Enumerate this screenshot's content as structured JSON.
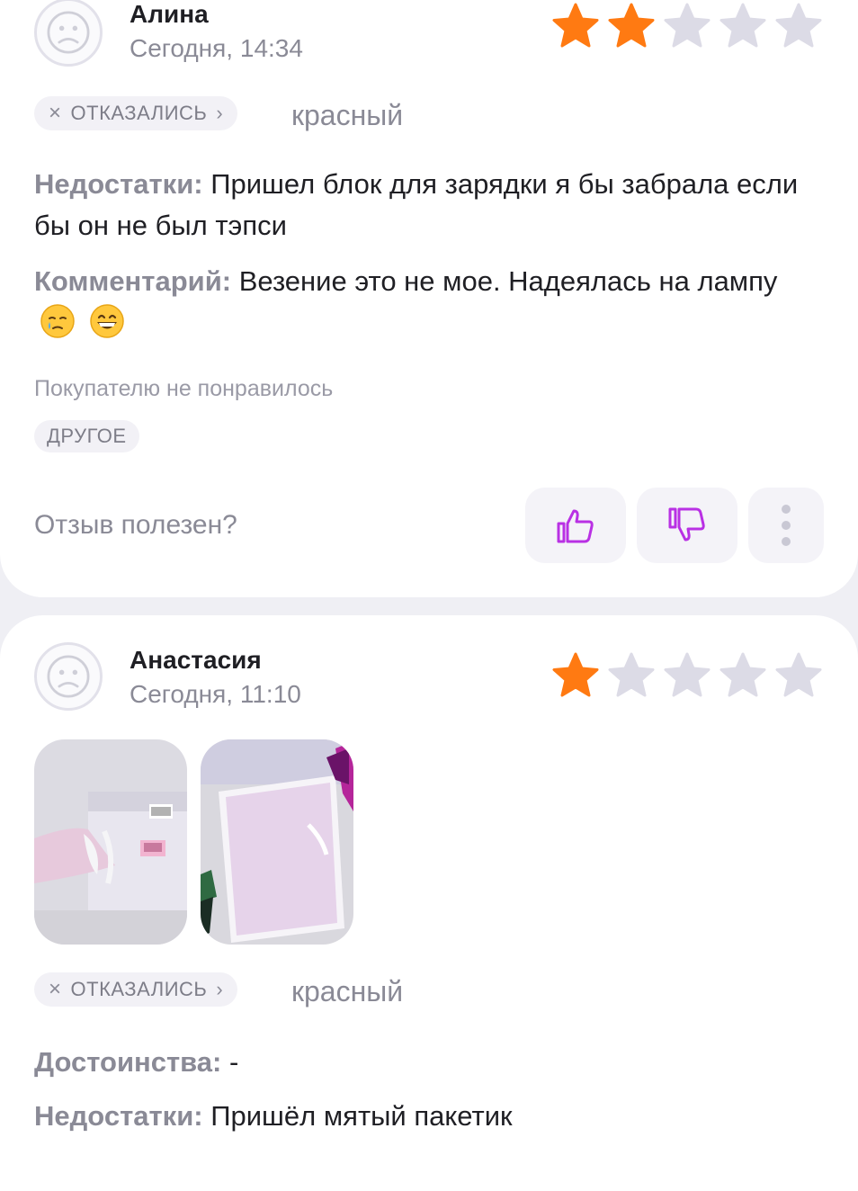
{
  "reviews": [
    {
      "author": "Алина",
      "date": "Сегодня, 14:34",
      "rating": 2,
      "max_rating": 5,
      "status_label": "ОТКАЗАЛИСЬ",
      "variant": "красный",
      "cons_label": "Недостатки:",
      "cons_text": "Пришел блок для зарядки я бы забрала если бы он не был тэпси",
      "comment_label": "Комментарий:",
      "comment_text": "Везение это не мое. Надеялась на лампу",
      "disliked_label": "Покупателю не понравилось",
      "disliked_tag": "ДРУГОЕ",
      "helpful_question": "Отзыв полезен?"
    },
    {
      "author": "Анастасия",
      "date": "Сегодня, 11:10",
      "rating": 1,
      "max_rating": 5,
      "status_label": "ОТКАЗАЛИСЬ",
      "variant": "красный",
      "pros_label": "Достоинства:",
      "pros_text": "-",
      "cons_label": "Недостатки:",
      "cons_text": "Пришёл мятый пакетик"
    }
  ],
  "colors": {
    "star_filled": "#ff7a12",
    "star_empty": "#dcdbe6",
    "accent": "#b930e4",
    "muted": "#8a8a96"
  },
  "icons": [
    "user-avatar-icon",
    "star-icon",
    "close-icon",
    "chevron-right-icon",
    "thumbs-up-icon",
    "thumbs-down-icon",
    "more-vertical-icon",
    "crying-face-emoji",
    "grinning-face-emoji"
  ]
}
